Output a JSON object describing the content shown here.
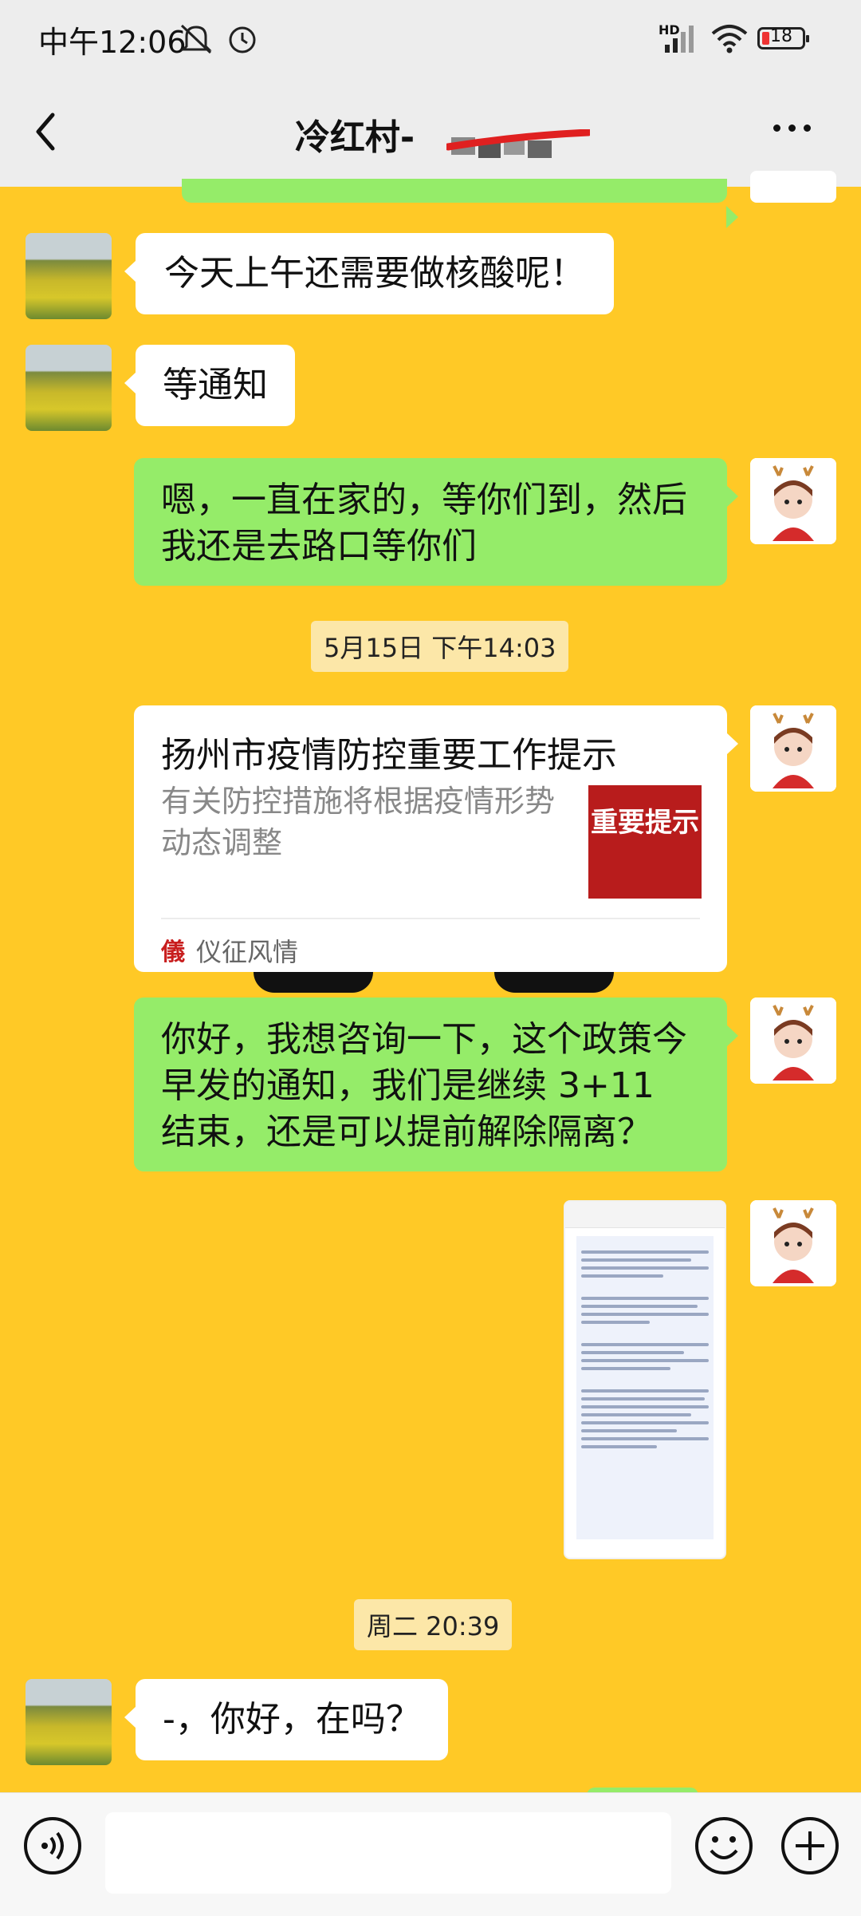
{
  "status_bar": {
    "time": "中午12:06",
    "network": "HD",
    "battery": "18"
  },
  "header": {
    "title": "冷红村-",
    "back_icon": "chevron-left-icon",
    "more_icon": "more-horizontal-icon"
  },
  "messages": {
    "m1": {
      "text": "今天上午还需要做核酸呢！"
    },
    "m2": {
      "text": "等通知"
    },
    "m3": {
      "text": "嗯，一直在家的，等你们到，然后我还是去路口等你们"
    },
    "ts1": "5月15日 下午14:03",
    "card": {
      "title": "扬州市疫情防控重要工作提示",
      "description": "有关防控措施将根据疫情形势动态调整",
      "thumb_text": "重要提示",
      "source_icon": "儀",
      "source": "仪征风情"
    },
    "m5": {
      "text": "你好，我想咨询一下，这个政策今早发的通知，我们是继续 3+11 结束，还是可以提前解除隔离？"
    },
    "ts2": "周二 20:39",
    "m7": {
      "text": "-，你好，在吗？"
    }
  },
  "input_bar": {
    "voice_icon": "voice-icon",
    "emoji_icon": "emoji-icon",
    "plus_icon": "plus-icon",
    "placeholder": ""
  },
  "colors": {
    "chat_background": "#FFC926",
    "outgoing_bubble": "#95EC69",
    "incoming_bubble": "#FFFFFF"
  }
}
